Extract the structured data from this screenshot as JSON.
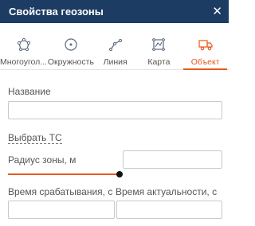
{
  "header": {
    "title": "Свойства геозоны",
    "close_icon": "close-icon"
  },
  "tabs": [
    {
      "label": "Многоугол...",
      "icon": "polygon-icon",
      "active": false
    },
    {
      "label": "Окружность",
      "icon": "circle-icon",
      "active": false
    },
    {
      "label": "Линия",
      "icon": "line-icon",
      "active": false
    },
    {
      "label": "Карта",
      "icon": "map-icon",
      "active": false
    },
    {
      "label": "Объект",
      "icon": "truck-icon",
      "active": true
    }
  ],
  "form": {
    "name_label": "Название",
    "name_value": "",
    "select_vehicle_link": "Выбрать ТС",
    "radius_label": "Радиус зоны, м",
    "radius_value": "",
    "radius_slider_level": 1.0,
    "trigger_time_label": "Время срабатывания, с",
    "trigger_time_value": "",
    "relevance_time_label": "Время актуальности, с",
    "relevance_time_value": ""
  },
  "colors": {
    "header_bg": "#1c3c63",
    "accent": "#e55a1c"
  }
}
